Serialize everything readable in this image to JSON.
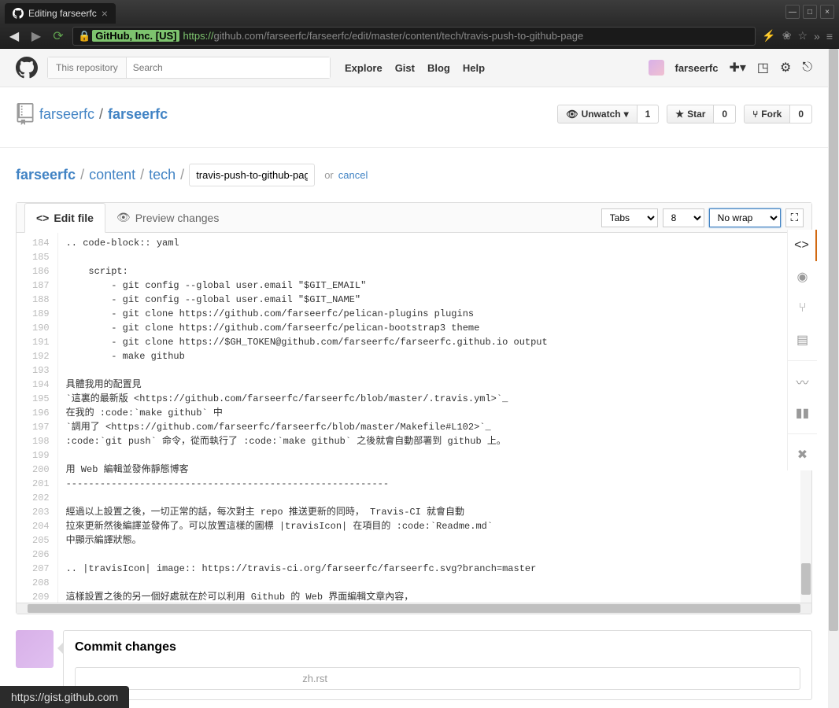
{
  "browser": {
    "tab_title": "Editing farseerfc",
    "url_ssl_org": "GitHub, Inc. [US]",
    "url_proto": "https://",
    "url_rest": "github.com/farseerfc/farseerfc/edit/master/content/tech/travis-push-to-github-page"
  },
  "header": {
    "search_scope": "This repository",
    "search_placeholder": "Search",
    "nav": {
      "explore": "Explore",
      "gist": "Gist",
      "blog": "Blog",
      "help": "Help"
    },
    "username": "farseerfc"
  },
  "repo": {
    "owner": "farseerfc",
    "name": "farseerfc",
    "unwatch_label": "Unwatch",
    "watch_count": "1",
    "star_label": "Star",
    "star_count": "0",
    "fork_label": "Fork",
    "fork_count": "0"
  },
  "breadcrumb": {
    "root": "farseerfc",
    "p1": "content",
    "p2": "tech",
    "filename": "travis-push-to-github-pag",
    "or": "or",
    "cancel": "cancel"
  },
  "editor": {
    "tab_edit": "Edit file",
    "tab_preview": "Preview changes",
    "indent_mode": "Tabs",
    "indent_size": "8",
    "wrap_mode": "No wrap",
    "line_start": 184,
    "lines": [
      ".. code-block:: yaml",
      "",
      "    script:",
      "        - git config --global user.email \"$GIT_EMAIL\"",
      "        - git config --global user.email \"$GIT_NAME\"",
      "        - git clone https://github.com/farseerfc/pelican-plugins plugins",
      "        - git clone https://github.com/farseerfc/pelican-bootstrap3 theme",
      "        - git clone https://$GH_TOKEN@github.com/farseerfc/farseerfc.github.io output",
      "        - make github",
      "",
      "具體我用的配置見",
      "`這裏的最新版 <https://github.com/farseerfc/farseerfc/blob/master/.travis.yml>`_",
      "在我的 :code:`make github` 中",
      "`調用了 <https://github.com/farseerfc/farseerfc/blob/master/Makefile#L102>`_",
      ":code:`git push` 命令，從而執行了 :code:`make github` 之後就會自動部署到 github 上。",
      "",
      "用 Web 編輯並發佈靜態博客",
      "---------------------------------------------------------",
      "",
      "經過以上設置之後，一切正常的話，每次對主 repo 推送更新的同時， Travis-CI 就會自動",
      "拉來更新然後編譯並發佈了。可以放置這樣的圖標 |travisIcon| 在項目的 :code:`Readme.md`",
      "中顯示編譯狀態。",
      "",
      ".. |travisIcon| image:: https://travis-ci.org/farseerfc/farseerfc.svg?branch=master",
      "",
      "這樣設置之後的另一個好處就在於可以利用 Github 的 Web 界面編輯文章內容，"
    ]
  },
  "commit": {
    "heading": "Commit changes",
    "placeholder_partial": "zh.rst"
  },
  "status_bar": "https://gist.github.com"
}
